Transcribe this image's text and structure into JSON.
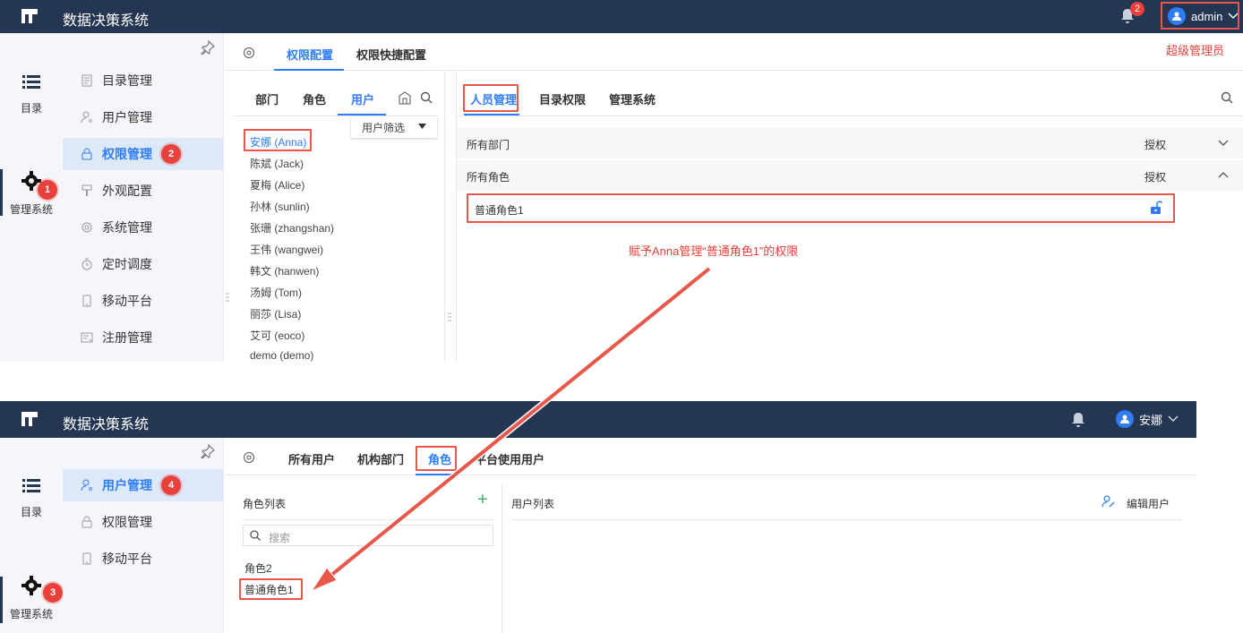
{
  "app_title": "数据决策系统",
  "shot1": {
    "notification_count": "2",
    "user_name": "admin",
    "super_admin_note": "超级管理员",
    "rail": {
      "catalog_label": "目录",
      "admin_label": "管理系统",
      "admin_step": "1"
    },
    "submenu": [
      {
        "label": "目录管理",
        "icon": "doc-icon"
      },
      {
        "label": "用户管理",
        "icon": "user-icon"
      },
      {
        "label": "权限管理",
        "icon": "lock-icon",
        "active": true,
        "step": "2"
      },
      {
        "label": "外观配置",
        "icon": "brush-icon"
      },
      {
        "label": "系统管理",
        "icon": "gear-icon"
      },
      {
        "label": "定时调度",
        "icon": "clock-icon"
      },
      {
        "label": "移动平台",
        "icon": "mobile-icon"
      },
      {
        "label": "注册管理",
        "icon": "register-icon"
      }
    ],
    "tabs": {
      "permission_config": "权限配置",
      "quick_config": "权限快捷配置"
    },
    "member_tabs": {
      "dept": "部门",
      "role": "角色",
      "user": "用户"
    },
    "user_filter": "用户筛选",
    "users": [
      "安娜 (Anna)",
      "陈斌 (Jack)",
      "夏梅 (Alice)",
      "孙林 (sunlin)",
      "张珊 (zhangshan)",
      "王伟 (wangwei)",
      "韩文 (hanwen)",
      "汤姆 (Tom)",
      "丽莎 (Lisa)",
      "艾可 (eoco)",
      "demo (demo)"
    ],
    "right_tabs": {
      "people": "人员管理",
      "catalog_perm": "目录权限",
      "admin_system": "管理系统"
    },
    "all_depts": "所有部门",
    "all_roles": "所有角色",
    "grant": "授权",
    "role_item": "普通角色1",
    "annotation": "赋予Anna管理“普通角色1”的权限"
  },
  "shot2": {
    "user_name": "安娜",
    "rail": {
      "catalog_label": "目录",
      "admin_label": "管理系统",
      "admin_step": "3"
    },
    "submenu": [
      {
        "label": "用户管理",
        "icon": "user-icon",
        "active": true,
        "step": "4"
      },
      {
        "label": "权限管理",
        "icon": "lock-icon"
      },
      {
        "label": "移动平台",
        "icon": "mobile-icon"
      }
    ],
    "tabs": {
      "all_users": "所有用户",
      "org_dept": "机构部门",
      "role": "角色",
      "platform_users": "平台使用用户"
    },
    "role_list_title": "角色列表",
    "search_placeholder": "搜索",
    "roles": [
      "角色2",
      "普通角色1"
    ],
    "user_list_title": "用户列表",
    "edit_users": "编辑用户"
  },
  "colors": {
    "topbar": "#243652",
    "accent": "#2f7df6",
    "annotation_red": "#e8403a"
  }
}
